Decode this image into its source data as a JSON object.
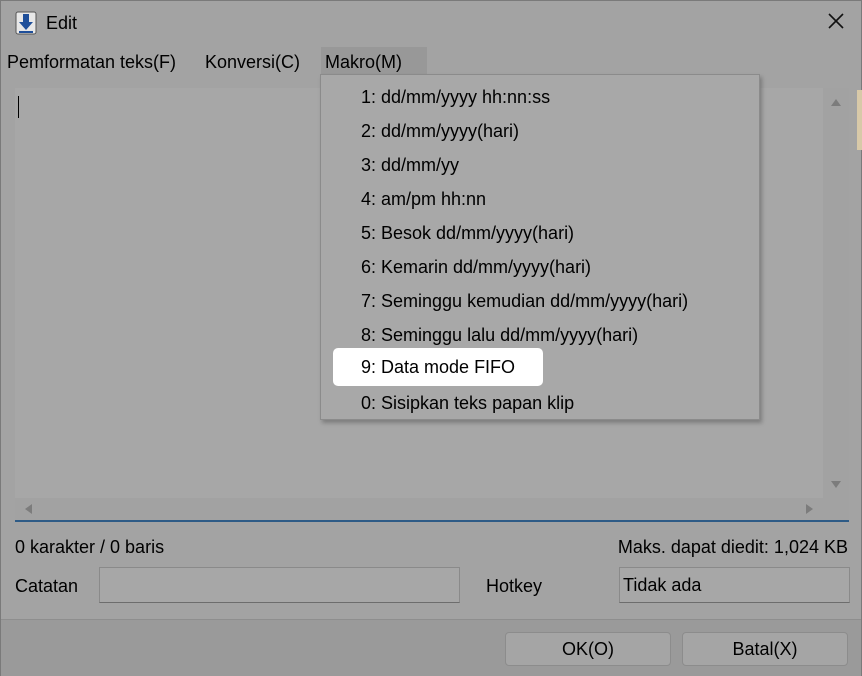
{
  "window": {
    "title": "Edit"
  },
  "menubar": {
    "items": [
      {
        "label": "Pemformatan teks(F)"
      },
      {
        "label": "Konversi(C)"
      },
      {
        "label": "Makro(M)"
      }
    ]
  },
  "macro_menu": {
    "items": [
      {
        "label": "1: dd/mm/yyyy hh:nn:ss"
      },
      {
        "label": "2: dd/mm/yyyy(hari)"
      },
      {
        "label": "3: dd/mm/yy"
      },
      {
        "label": "4: am/pm hh:nn"
      },
      {
        "label": "5: Besok dd/mm/yyyy(hari)"
      },
      {
        "label": "6: Kemarin dd/mm/yyyy(hari)"
      },
      {
        "label": "7: Seminggu kemudian dd/mm/yyyy(hari)"
      },
      {
        "label": "8: Seminggu lalu dd/mm/yyyy(hari)"
      },
      {
        "label": "9: Data mode FIFO"
      },
      {
        "label": "0: Sisipkan teks papan klip"
      }
    ],
    "selected_index": 8
  },
  "editor": {
    "value": ""
  },
  "status": {
    "counts": "0 karakter / 0 baris",
    "max_size": "Maks. dapat diedit: 1,024 KB"
  },
  "note": {
    "label": "Catatan",
    "value": ""
  },
  "hotkey": {
    "label": "Hotkey",
    "value": "Tidak ada"
  },
  "buttons": {
    "ok": "OK(O)",
    "cancel": "Batal(X)"
  },
  "icons": {
    "app": "download-arrow-icon",
    "close": "close-icon"
  }
}
